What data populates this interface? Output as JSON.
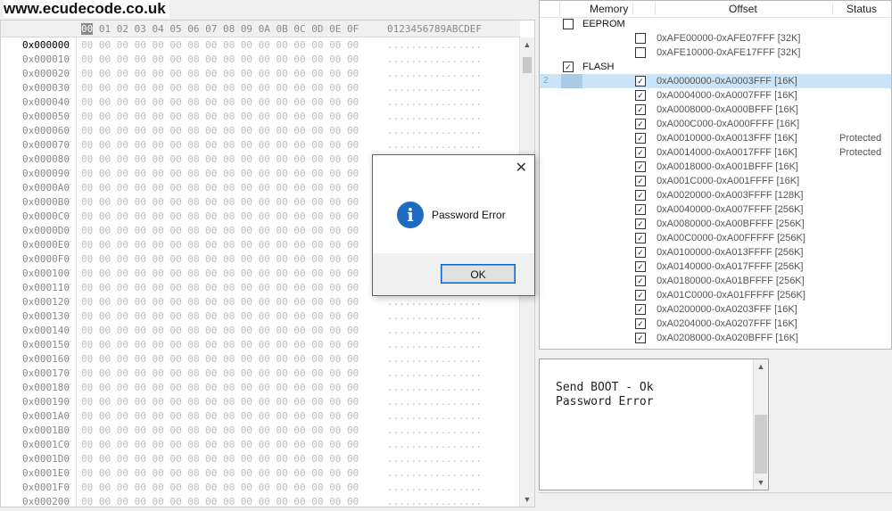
{
  "watermark": "www.ecudecode.co.uk",
  "hex": {
    "first_col": "00",
    "header_cols": " 01 02 03 04 05 06 07 08 09 0A 0B 0C 0D 0E 0F",
    "ascii_header": "0123456789ABCDEF",
    "byte_row": "00 00 00 00 00 00 00 00 00 00 00 00 00 00 00 00",
    "ascii_row": "................",
    "addresses": [
      "0x000000",
      "0x000010",
      "0x000020",
      "0x000030",
      "0x000040",
      "0x000050",
      "0x000060",
      "0x000070",
      "0x000080",
      "0x000090",
      "0x0000A0",
      "0x0000B0",
      "0x0000C0",
      "0x0000D0",
      "0x0000E0",
      "0x0000F0",
      "0x000100",
      "0x000110",
      "0x000120",
      "0x000130",
      "0x000140",
      "0x000150",
      "0x000160",
      "0x000170",
      "0x000180",
      "0x000190",
      "0x0001A0",
      "0x0001B0",
      "0x0001C0",
      "0x0001D0",
      "0x0001E0",
      "0x0001F0",
      "0x000200"
    ]
  },
  "memory_table": {
    "headers": {
      "memory": "Memory",
      "offset": "Offset",
      "status": "Status"
    },
    "rows": [
      {
        "kind": "group",
        "label": "EEPROM",
        "checked": false
      },
      {
        "kind": "item",
        "offset": "0xAFE00000-0xAFE07FFF [32K]",
        "checked": false,
        "status": ""
      },
      {
        "kind": "item",
        "offset": "0xAFE10000-0xAFE17FFF [32K]",
        "checked": false,
        "status": ""
      },
      {
        "kind": "group",
        "label": "FLASH",
        "checked": true
      },
      {
        "kind": "item",
        "offset": "0xA0000000-0xA0003FFF [16K]",
        "checked": true,
        "status": "",
        "selected": true,
        "rownum": "2"
      },
      {
        "kind": "item",
        "offset": "0xA0004000-0xA0007FFF [16K]",
        "checked": true,
        "status": ""
      },
      {
        "kind": "item",
        "offset": "0xA0008000-0xA000BFFF [16K]",
        "checked": true,
        "status": ""
      },
      {
        "kind": "item",
        "offset": "0xA000C000-0xA000FFFF [16K]",
        "checked": true,
        "status": ""
      },
      {
        "kind": "item",
        "offset": "0xA0010000-0xA0013FFF [16K]",
        "checked": true,
        "status": "Protected"
      },
      {
        "kind": "item",
        "offset": "0xA0014000-0xA0017FFF [16K]",
        "checked": true,
        "status": "Protected"
      },
      {
        "kind": "item",
        "offset": "0xA0018000-0xA001BFFF [16K]",
        "checked": true,
        "status": ""
      },
      {
        "kind": "item",
        "offset": "0xA001C000-0xA001FFFF [16K]",
        "checked": true,
        "status": ""
      },
      {
        "kind": "item",
        "offset": "0xA0020000-0xA003FFFF [128K]",
        "checked": true,
        "status": ""
      },
      {
        "kind": "item",
        "offset": "0xA0040000-0xA007FFFF [256K]",
        "checked": true,
        "status": ""
      },
      {
        "kind": "item",
        "offset": "0xA0080000-0xA00BFFFF [256K]",
        "checked": true,
        "status": ""
      },
      {
        "kind": "item",
        "offset": "0xA00C0000-0xA00FFFFF [256K]",
        "checked": true,
        "status": ""
      },
      {
        "kind": "item",
        "offset": "0xA0100000-0xA013FFFF [256K]",
        "checked": true,
        "status": ""
      },
      {
        "kind": "item",
        "offset": "0xA0140000-0xA017FFFF [256K]",
        "checked": true,
        "status": ""
      },
      {
        "kind": "item",
        "offset": "0xA0180000-0xA01BFFFF [256K]",
        "checked": true,
        "status": ""
      },
      {
        "kind": "item",
        "offset": "0xA01C0000-0xA01FFFFF [256K]",
        "checked": true,
        "status": ""
      },
      {
        "kind": "item",
        "offset": "0xA0200000-0xA0203FFF [16K]",
        "checked": true,
        "status": ""
      },
      {
        "kind": "item",
        "offset": "0xA0204000-0xA0207FFF [16K]",
        "checked": true,
        "status": ""
      },
      {
        "kind": "item",
        "offset": "0xA0208000-0xA020BFFF [16K]",
        "checked": true,
        "status": ""
      }
    ]
  },
  "log": {
    "lines": [
      "Send BOOT - Ok",
      "Password Error"
    ]
  },
  "dialog": {
    "message": "Password Error",
    "ok_label": "OK",
    "close_glyph": "✕",
    "info_glyph": "i"
  },
  "icons": {
    "check_glyph": "✓",
    "scroll_up": "▲",
    "scroll_down": "▼"
  },
  "colors": {
    "selected_row": "#cce4f7",
    "dialog_border": "#1874c6",
    "info_icon": "#1e6bc1"
  }
}
